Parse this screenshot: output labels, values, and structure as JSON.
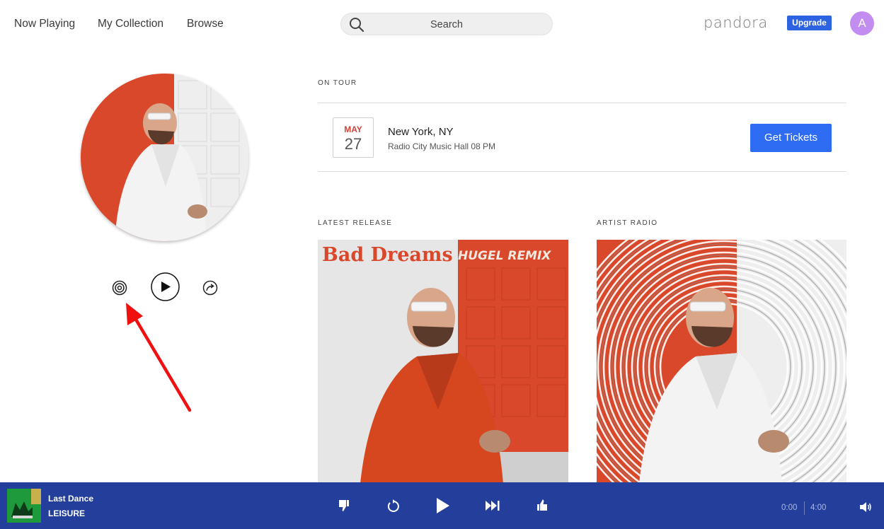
{
  "nav": {
    "now_playing": "Now Playing",
    "my_collection": "My Collection",
    "browse": "Browse",
    "search_placeholder": "Search",
    "logo": "pandora",
    "upgrade": "Upgrade",
    "avatar_initial": "A"
  },
  "on_tour": {
    "label": "ON TOUR",
    "month": "MAY",
    "day": "27",
    "city": "New York, NY",
    "venue": "Radio City Music Hall 08 PM",
    "tickets_label": "Get Tickets"
  },
  "latest_release": {
    "label": "LATEST RELEASE",
    "art_title": "Bad Dreams",
    "art_subtitle": "HUGEL REMIX"
  },
  "artist_radio": {
    "label": "ARTIST RADIO"
  },
  "player": {
    "title": "Last Dance",
    "artist": "LEISURE",
    "elapsed": "0:00",
    "duration": "4:00"
  },
  "colors": {
    "accent": "#2f6cf4",
    "player_bg": "#233f9b",
    "date_month": "#d0423a",
    "annotation_arrow": "#f01010",
    "art_orange": "#d9482a"
  },
  "icons": {
    "radio_station": "radio-waves-icon",
    "play": "play-icon",
    "share": "share-arrow-icon",
    "search": "search-icon",
    "thumbs_down": "thumbs-down-icon",
    "replay": "replay-icon",
    "skip": "skip-forward-icon",
    "thumbs_up": "thumbs-up-icon",
    "volume": "volume-icon"
  }
}
